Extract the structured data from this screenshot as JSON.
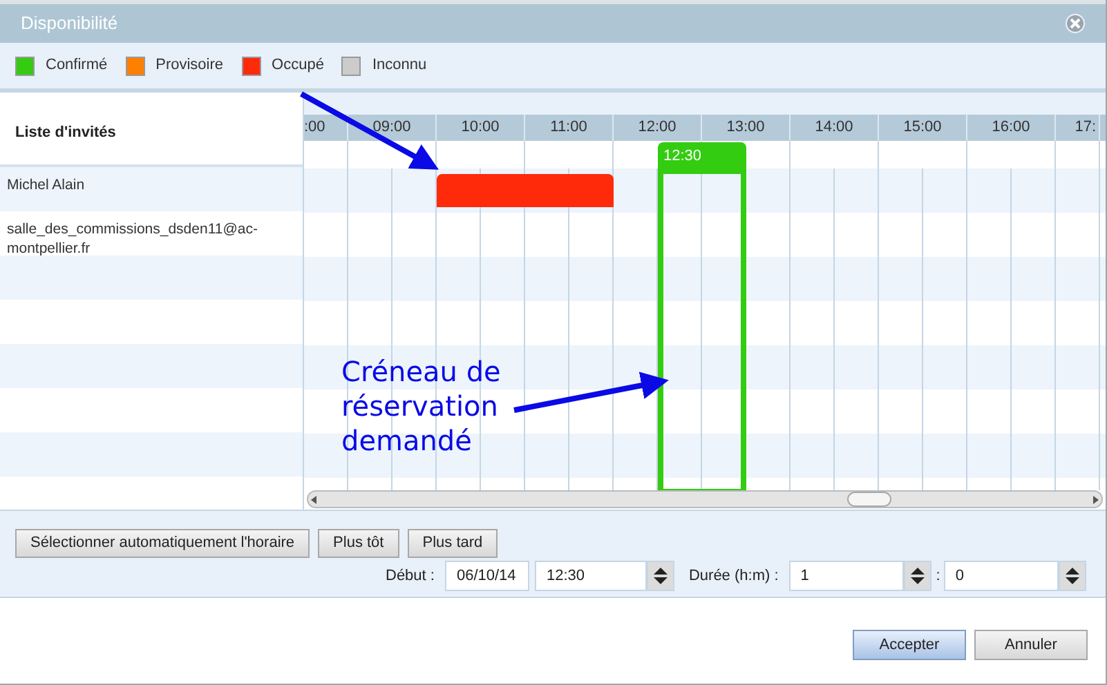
{
  "window": {
    "title": "Disponibilité"
  },
  "legend": [
    {
      "label": "Confirmé",
      "color": "#33cc11"
    },
    {
      "label": "Provisoire",
      "color": "#ff7f00"
    },
    {
      "label": "Occupé",
      "color": "#ff2a0a"
    },
    {
      "label": "Inconnu",
      "color": "#cccccc"
    }
  ],
  "attendee_list": {
    "header": "Liste d'invités",
    "attendees": [
      {
        "name": "Michel Alain"
      },
      {
        "name": "salle_des_commissions_dsden11@ac-montpellier.fr"
      }
    ]
  },
  "timeline": {
    "hours": [
      ":00",
      "09:00",
      "10:00",
      "11:00",
      "12:00",
      "13:00",
      "14:00",
      "15:00",
      "16:00",
      "17:"
    ],
    "busy_blocks": [
      {
        "kind": "busy",
        "color": "#ff2a0a"
      }
    ],
    "selection": {
      "label": "12:30",
      "color": "#33cc11"
    }
  },
  "annotations": [
    {
      "kind": "arrow"
    },
    {
      "kind": "callout",
      "text": "Créneau de réservation demandé"
    }
  ],
  "actions": {
    "buttons": [
      "Sélectionner automatiquement l'horaire",
      "Plus tôt",
      "Plus tard"
    ],
    "start_label": "Début :",
    "start_date": "06/10/14",
    "start_time": "12:30",
    "duration_label": "Durée (h:m) :",
    "duration_hours": "1",
    "duration_separator": ":",
    "duration_minutes": "0"
  },
  "footer_buttons": [
    {
      "label": "Accepter",
      "primary": true
    },
    {
      "label": "Annuler",
      "primary": false
    }
  ]
}
